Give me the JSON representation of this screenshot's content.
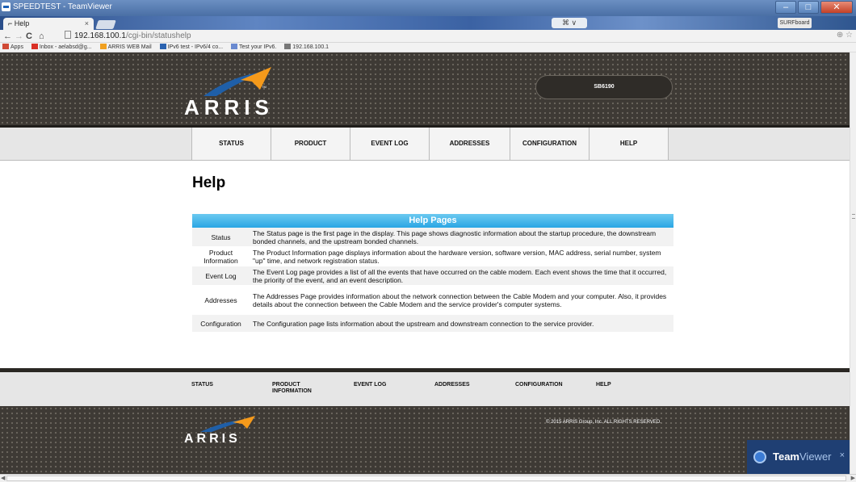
{
  "window": {
    "title": "SPEEDTEST - TeamViewer"
  },
  "tab": {
    "label": "Help",
    "close": "×"
  },
  "tab_strip": {
    "middle": "⌘ ∨",
    "pill": "SURFboard"
  },
  "address": {
    "host": "192.168.100.1",
    "path": "/cgi-bin/statushelp"
  },
  "bookmarks": [
    {
      "label": "Apps",
      "color": "#d04a36"
    },
    {
      "label": "Inbox - aelabsd@g...",
      "color": "#d93025"
    },
    {
      "label": "ARRIS WEB Mail",
      "color": "#f0a020"
    },
    {
      "label": "IPv6 test - IPv6/4 co...",
      "color": "#2a62b0"
    },
    {
      "label": "Test your IPv6.",
      "color": "#6a8ad0"
    },
    {
      "label": "192.168.100.1",
      "color": "#777777"
    }
  ],
  "header": {
    "logo": "ARRIS",
    "model": "SB6190"
  },
  "nav": [
    "STATUS",
    "PRODUCT INFORMATION",
    "EVENT LOG",
    "ADDRESSES",
    "CONFIGURATION",
    "HELP"
  ],
  "content": {
    "title": "Help",
    "table_title": "Help Pages",
    "rows": [
      {
        "name": "Status",
        "desc": "The Status page is the first page in the display. This page shows diagnostic information about the startup procedure, the downstream bonded channels, and the upstream bonded channels."
      },
      {
        "name": "Product Information",
        "desc": "The Product Information page displays information about the hardware version, software version, MAC address, serial number, system \"up\" time, and network registration status."
      },
      {
        "name": "Event Log",
        "desc": "The Event Log page provides a list of all the events that have occurred on the cable modem. Each event shows the time that it occurred, the priority of the event, and an event description."
      },
      {
        "name": "Addresses",
        "desc": "The Addresses Page provides information about the network connection between the Cable Modem and your computer. Also, it provides details about the connection between the Cable Modem and the service provider's computer systems."
      },
      {
        "name": "Configuration",
        "desc": "The Configuration page lists information about the upstream and downstream connection to the service provider."
      }
    ]
  },
  "footer_nav": {
    "status": "STATUS",
    "product_line1": "PRODUCT",
    "product_line2": "INFORMATION",
    "event_log": "EVENT LOG",
    "addresses": "ADDRESSES",
    "configuration": "CONFIGURATION",
    "help": "HELP"
  },
  "footer": {
    "logo": "ARRIS",
    "copyright": "© 2015 ARRIS Group, Inc. ALL RIGHTS RESERVED."
  },
  "teamviewer": {
    "brand_bold": "Team",
    "brand_light": "Viewer",
    "close": "×"
  },
  "colors": {
    "accent": "#2aa6e4",
    "header_bg": "#3e3a35",
    "logo_orange": "#f59a1b",
    "logo_blue": "#1f5fa8"
  }
}
